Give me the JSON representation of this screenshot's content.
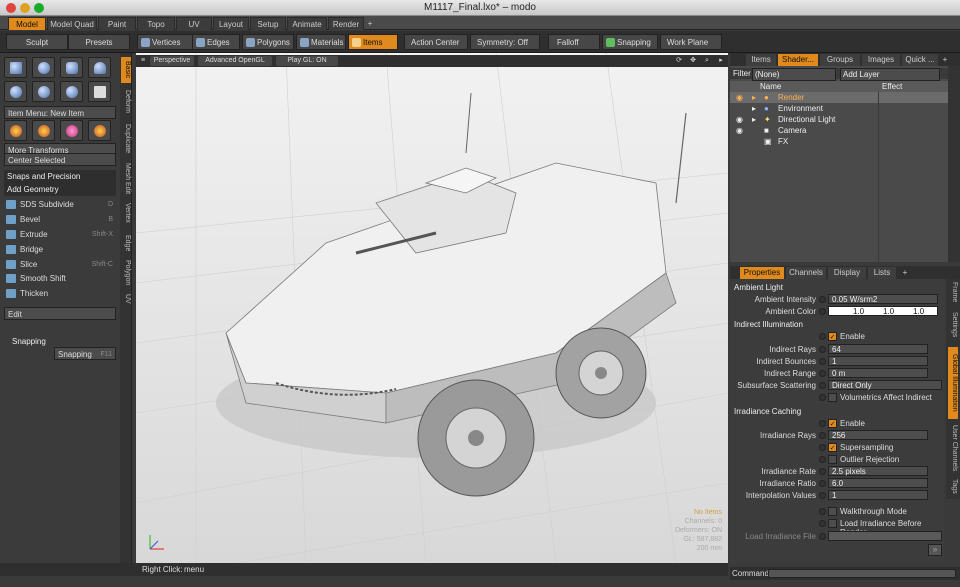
{
  "window": {
    "title": "M1117_Final.lxo* – modo"
  },
  "mode_tabs": [
    "Model",
    "Model Quad",
    "Paint",
    "Topo",
    "UV",
    "Layout",
    "Setup",
    "Animate",
    "Render",
    "+"
  ],
  "toolbar": {
    "sculpt": "Sculpt",
    "presets": "Presets",
    "vertices": "Vertices",
    "edges": "Edges",
    "polygons": "Polygons",
    "materials": "Materials",
    "items": "Items",
    "action_center": "Action Center",
    "symmetry": "Symmetry: Off",
    "falloff": "Falloff",
    "snapping": "Snapping",
    "work_plane": "Work Plane"
  },
  "left": {
    "item_menu": "Item Menu: New Item",
    "more_transforms": "More Transforms",
    "center_selected": "Center Selected",
    "snaps": "Snaps and Precision",
    "add_geometry": "Add Geometry",
    "tools": [
      {
        "label": "SDS Subdivide",
        "shortcut": "D"
      },
      {
        "label": "Bevel",
        "shortcut": "B"
      },
      {
        "label": "Extrude",
        "shortcut": "Shift-X"
      },
      {
        "label": "Bridge",
        "shortcut": ""
      },
      {
        "label": "Slice",
        "shortcut": "Shift-C"
      },
      {
        "label": "Smooth Shift",
        "shortcut": ""
      },
      {
        "label": "Thicken",
        "shortcut": ""
      }
    ],
    "edit": "Edit",
    "snapping_header": "Snapping",
    "snapping_item": "Snapping",
    "snapping_key": "F11"
  },
  "vtabs": [
    "Basic",
    "Deform",
    "Duplicate",
    "Mesh Edit",
    "Vertex",
    "Edge",
    "Polygon",
    "UV"
  ],
  "viewport": {
    "view": "Perspective",
    "shading": "Advanced OpenGL",
    "play": "Play GL: ON",
    "stats": [
      "No Items",
      "Channels: 0",
      "Deformers: ON",
      "GL: 587,882",
      "200 mm"
    ]
  },
  "status": {
    "label": "Right Click:",
    "value": "menu"
  },
  "right_tabs": [
    "Items",
    "Shader...",
    "Groups",
    "Images",
    "Quick ...",
    "+"
  ],
  "shader": {
    "filter_label": "Filter",
    "filter_value": "(None)",
    "add_layer": "Add Layer",
    "col_name": "Name",
    "col_effect": "Effect",
    "rows": [
      "Render",
      "Environment",
      "Directional Light",
      "Camera",
      "FX"
    ]
  },
  "prop_tabs": [
    "Properties",
    "Channels",
    "Display",
    "Lists",
    "+"
  ],
  "props": {
    "ambient_light": "Ambient Light",
    "ambient_intensity_label": "Ambient Intensity",
    "ambient_intensity": "0.05 W/srm2",
    "ambient_color_label": "Ambient Color",
    "ambient_color": [
      "1.0",
      "1.0",
      "1.0"
    ],
    "indirect": "Indirect Illumination",
    "enable": "Enable",
    "indirect_rays_label": "Indirect Rays",
    "indirect_rays": "64",
    "indirect_bounces_label": "Indirect Bounces",
    "indirect_bounces": "1",
    "indirect_range_label": "Indirect Range",
    "indirect_range": "0 m",
    "subsurface_label": "Subsurface Scattering",
    "subsurface": "Direct Only",
    "volumetrics": "Volumetrics Affect Indirect",
    "irradiance": "Irradiance Caching",
    "irr_enable": "Enable",
    "irr_rays_label": "Irradiance Rays",
    "irr_rays": "256",
    "supersampling": "Supersampling",
    "outlier": "Outlier Rejection",
    "irr_rate_label": "Irradiance Rate",
    "irr_rate": "2.5 pixels",
    "irr_ratio_label": "Irradiance Ratio",
    "irr_ratio": "6.0",
    "interp_label": "Interpolation Values",
    "interp": "1",
    "walkthrough": "Walkthrough Mode",
    "load_before": "Load Irradiance Before Render",
    "load_file_label": "Load Irradiance File"
  },
  "prop_vtabs": [
    "Frame",
    "Settings",
    "Global Illumination",
    "User Channels",
    "Tags"
  ],
  "command": "Command"
}
